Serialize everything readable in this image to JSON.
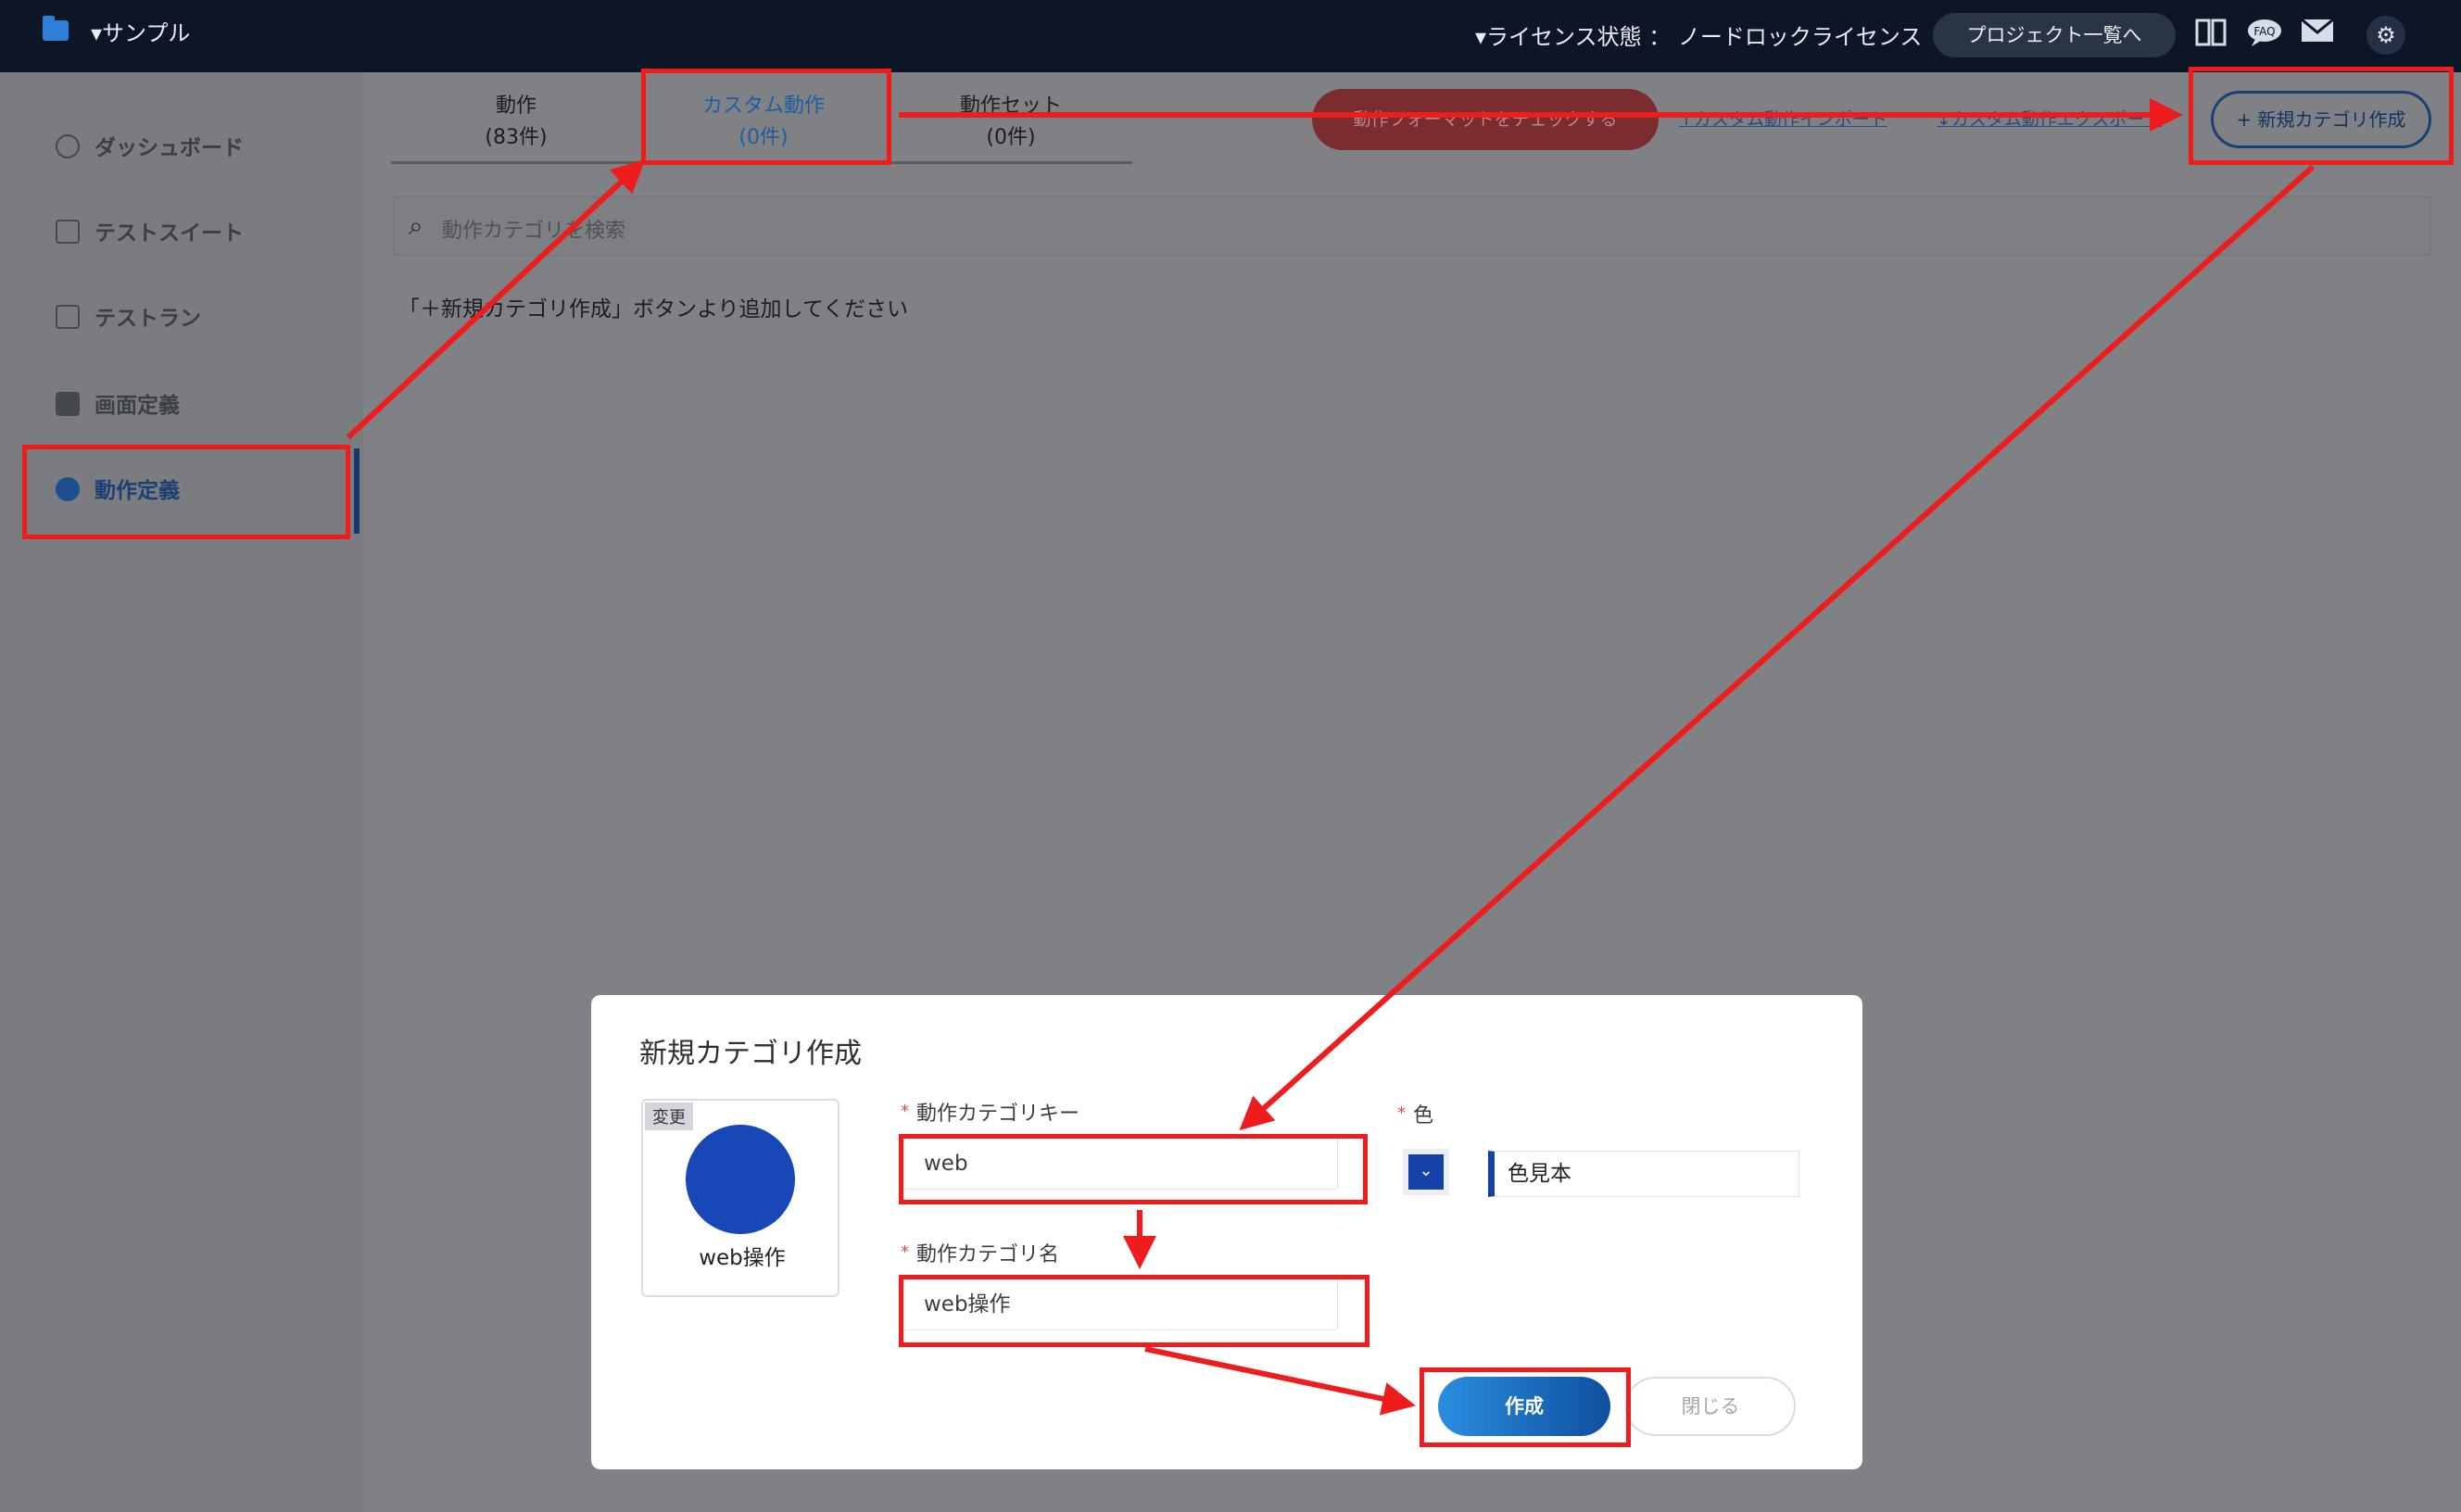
{
  "topbar": {
    "project_name": "▾サンプル",
    "license": "▾ライセンス状態 ： ノードロックライセンス",
    "project_list_button": "プロジェクト一覧へ",
    "faq_label": "FAQ"
  },
  "sidebar": {
    "items": [
      {
        "label": "ダッシュボード",
        "icon": "clock-icon"
      },
      {
        "label": "テストスイート",
        "icon": "list-icon"
      },
      {
        "label": "テストラン",
        "icon": "clipboard-icon"
      },
      {
        "label": "画面定義",
        "icon": "monitor-icon"
      },
      {
        "label": "動作定義",
        "icon": "check-circle-icon",
        "active": true
      }
    ]
  },
  "main": {
    "tabs": [
      {
        "label": "動作",
        "count": "(83件)"
      },
      {
        "label": "カスタム動作",
        "count": "(0件)",
        "active": true
      },
      {
        "label": "動作セット",
        "count": "(0件)"
      }
    ],
    "format_check_button": "動作フォーマットをチェックする",
    "import_link": "↑カスタム動作インポート",
    "export_link": "↓カスタム動作エクスポート",
    "new_category_button": "+ 新規カテゴリ作成",
    "search_placeholder": "動作カテゴリを検索",
    "empty_hint": "「＋新規カテゴリ作成」ボタンより追加してください"
  },
  "dialog": {
    "title": "新規カテゴリ作成",
    "preview_change_tag": "変更",
    "preview_name": "web操作",
    "key_label": "動作カテゴリキー",
    "key_value": "web",
    "name_label": "動作カテゴリ名",
    "name_value": "web操作",
    "color_label": "色",
    "color_sample": "色見本",
    "color_value": "#1642a8",
    "create_button": "作成",
    "close_button": "閉じる"
  },
  "colors": {
    "annotation_red": "#ee1c1c",
    "accent_blue": "#1f5ea0",
    "topbar_bg": "#0d1626"
  }
}
